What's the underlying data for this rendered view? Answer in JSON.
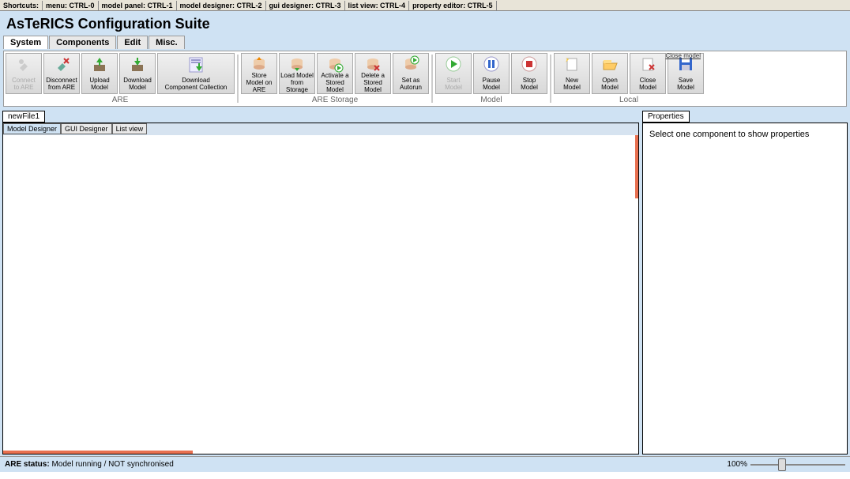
{
  "shortcuts": {
    "label": "Shortcuts:",
    "items": [
      "menu: CTRL-0",
      "model panel: CTRL-1",
      "model designer: CTRL-2",
      "gui designer: CTRL-3",
      "list view: CTRL-4",
      "property editor: CTRL-5"
    ]
  },
  "app_title": "AsTeRICS Configuration Suite",
  "menu_tabs": [
    "System",
    "Components",
    "Edit",
    "Misc."
  ],
  "active_menu": 0,
  "toolbar": {
    "groups": [
      {
        "label": "ARE",
        "buttons": [
          {
            "l1": "Connect",
            "l2": "to ARE",
            "icon": "plug",
            "disabled": true
          },
          {
            "l1": "Disconnect",
            "l2": "from ARE",
            "icon": "plug-x"
          },
          {
            "l1": "Upload",
            "l2": "Model",
            "icon": "upload"
          },
          {
            "l1": "Download",
            "l2": "Model",
            "icon": "download"
          },
          {
            "l1": "Download",
            "l2": "Component Collection",
            "icon": "download-coll",
            "wide": true
          }
        ]
      },
      {
        "label": "ARE Storage",
        "buttons": [
          {
            "l1": "Store",
            "l2": "Model on ARE",
            "icon": "db-up"
          },
          {
            "l1": "Load Model",
            "l2": "from Storage",
            "icon": "db-down"
          },
          {
            "l1": "Activate a",
            "l2": "Stored Model",
            "icon": "db-play"
          },
          {
            "l1": "Delete a",
            "l2": "Stored Model",
            "icon": "db-del"
          },
          {
            "l1": "Set as",
            "l2": "Autorun",
            "icon": "db-auto"
          }
        ]
      },
      {
        "label": "Model",
        "buttons": [
          {
            "l1": "Start",
            "l2": "Model",
            "icon": "play",
            "disabled": true
          },
          {
            "l1": "Pause",
            "l2": "Model",
            "icon": "pause"
          },
          {
            "l1": "Stop",
            "l2": "Model",
            "icon": "stop"
          }
        ]
      },
      {
        "label": "Local",
        "buttons": [
          {
            "l1": "New",
            "l2": "Model",
            "icon": "new"
          },
          {
            "l1": "Open",
            "l2": "Model",
            "icon": "open"
          },
          {
            "l1": "Close",
            "l2": "Model",
            "icon": "close"
          },
          {
            "l1": "Save",
            "l2": "Model",
            "icon": "save"
          }
        ]
      }
    ],
    "close_label": "Close model"
  },
  "file_tab": "newFile1",
  "designer_tabs": [
    "Model Designer",
    "GUI Designer",
    "List view"
  ],
  "active_designer_tab": 0,
  "properties": {
    "tab": "Properties",
    "empty_text": "Select one component to show properties"
  },
  "status": {
    "label": "ARE status:",
    "text": "Model running / NOT synchronised",
    "zoom": "100%"
  }
}
